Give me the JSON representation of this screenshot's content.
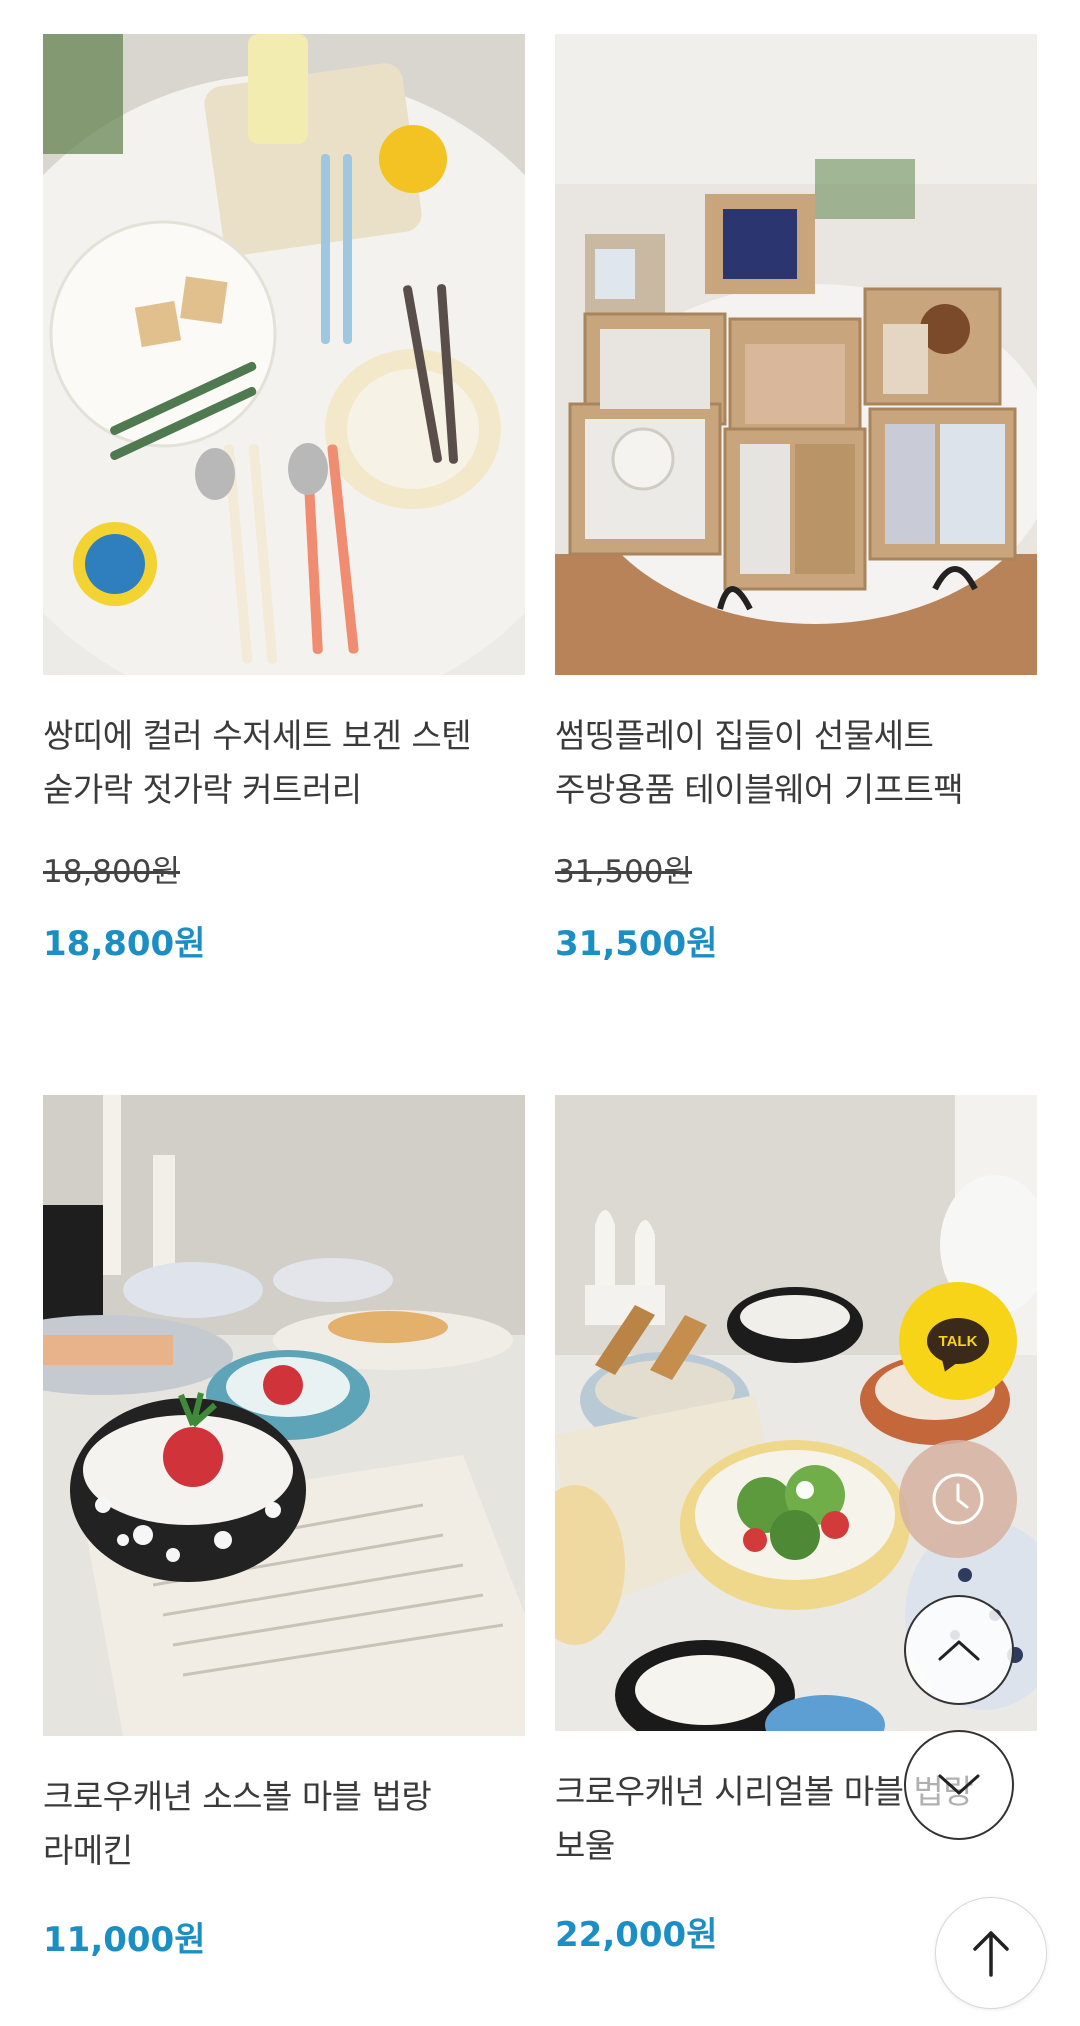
{
  "products": [
    {
      "title": "쌍띠에 컬러 수저세트 보겐 스텐 숟가락 젓가락 커트러리",
      "original_price": "18,800원",
      "price": "18,800원",
      "image_alt": "colorful cutlery set on white table"
    },
    {
      "title": "썸띵플레이 집들이 선물세트 주방용품 테이블웨어 기프트팩",
      "original_price": "31,500원",
      "price": "31,500원",
      "image_alt": "gift boxes with kitchenware"
    },
    {
      "title": "크로우캐년 소스볼 마블 법랑 라메킨",
      "price": "11,000원",
      "image_alt": "marble enamel sauce bowls with strawberries"
    },
    {
      "title": "크로우캐년 시리얼볼 마블 법랑 보울",
      "price": "22,000원",
      "image_alt": "marble enamel cereal bowls with salad"
    }
  ],
  "floating": {
    "talk_label": "TALK"
  },
  "colors": {
    "price": "#1b8fc4",
    "talk_bg": "#f7d417",
    "recent_bg": "#d6b2a0"
  }
}
